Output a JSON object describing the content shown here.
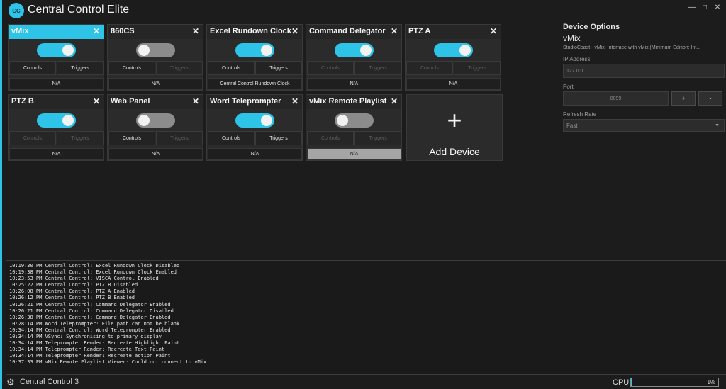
{
  "app": {
    "title": "Central Control Elite",
    "logo": "CC"
  },
  "window_controls": [
    "—",
    "□",
    "✕"
  ],
  "devices": [
    {
      "name": "vMix",
      "enabled": true,
      "selected": true,
      "controls": "Controls",
      "triggers": "Triggers",
      "controls_enabled": true,
      "triggers_enabled": true,
      "status": "N/A"
    },
    {
      "name": "860CS",
      "enabled": false,
      "selected": false,
      "controls": "Controls",
      "triggers": "Triggers",
      "controls_enabled": true,
      "triggers_enabled": false,
      "status": "N/A"
    },
    {
      "name": "Excel Rundown Clock",
      "enabled": true,
      "selected": false,
      "controls": "Controls",
      "triggers": "Triggers",
      "controls_enabled": true,
      "triggers_enabled": true,
      "status": "Central Control Rundown Clock"
    },
    {
      "name": "Command Delegator",
      "enabled": true,
      "selected": false,
      "controls": "Controls",
      "triggers": "Triggers",
      "controls_enabled": false,
      "triggers_enabled": false,
      "status": "N/A"
    },
    {
      "name": "PTZ A",
      "enabled": true,
      "selected": false,
      "controls": "Controls",
      "triggers": "Triggers",
      "controls_enabled": false,
      "triggers_enabled": false,
      "status": "N/A"
    },
    {
      "name": "PTZ B",
      "enabled": true,
      "selected": false,
      "controls": "Controls",
      "triggers": "Triggers",
      "controls_enabled": false,
      "triggers_enabled": false,
      "status": "N/A"
    },
    {
      "name": "Web Panel",
      "enabled": false,
      "selected": false,
      "controls": "Controls",
      "triggers": "Triggers",
      "controls_enabled": true,
      "triggers_enabled": false,
      "status": "N/A"
    },
    {
      "name": "Word Teleprompter",
      "enabled": true,
      "selected": false,
      "controls": "Controls",
      "triggers": "Triggers",
      "controls_enabled": true,
      "triggers_enabled": true,
      "status": "N/A"
    },
    {
      "name": "vMix Remote Playlist",
      "enabled": false,
      "selected": false,
      "controls": "Controls",
      "triggers": "Triggers",
      "controls_enabled": false,
      "triggers_enabled": false,
      "status": "N/A",
      "status_highlight": true
    }
  ],
  "add_device": {
    "plus": "+",
    "label": "Add Device"
  },
  "side_panel": {
    "heading": "Device Options",
    "device_name": "vMix",
    "description": "StudioCoast - vMix: Interface with vMix (Minimum Edition: Int...",
    "ip_label": "IP Address",
    "ip_value": "127.0.0.1",
    "port_label": "Port",
    "port_value": "8099",
    "port_plus": "+",
    "port_minus": "-",
    "refresh_label": "Refresh Rate",
    "refresh_value": "Fast"
  },
  "log": [
    "10:19:30 PM Central Control: Excel Rundown Clock Disabled",
    "10:19:38 PM Central Control: Excel Rundown Clock Enabled",
    "10:23:53 PM Central Control: VISCA Control Enabled",
    "10:25:22 PM Central Control: PTZ B Disabled",
    "10:26:08 PM Central Control: PTZ A Enabled",
    "10:26:12 PM Central Control: PTZ B Enabled",
    "10:26:21 PM Central Control: Command Delegator Enabled",
    "10:26:21 PM Central Control: Command Delegator Disabled",
    "10:26:38 PM Central Control: Command Delegator Enabled",
    "10:28:14 PM Word Teleprompter: File path can not be blank",
    "10:34:14 PM Central Control: Word Teleprompter Enabled",
    "10:34:14 PM VSync: Synchronising to primary display",
    "10:34:14 PM Teleprompter Render: Recreate Highlight Paint",
    "10:34:14 PM Teleprompter Render: Recreate Text Paint",
    "10:34:14 PM Teleprompter Render: Recreate action Paint",
    "10:37:33 PM vMix Remote Playlist Viewer: Could not connect to vMix"
  ],
  "status_bar": {
    "label": "Central Control 3",
    "gear_icon": "gear-icon",
    "cpu_label": "CPU",
    "cpu_value": "1%",
    "cpu_fraction": 0.01
  },
  "colors": {
    "accent": "#2ec4e8",
    "background": "#1c1c1c",
    "card": "#2b2b2b"
  }
}
